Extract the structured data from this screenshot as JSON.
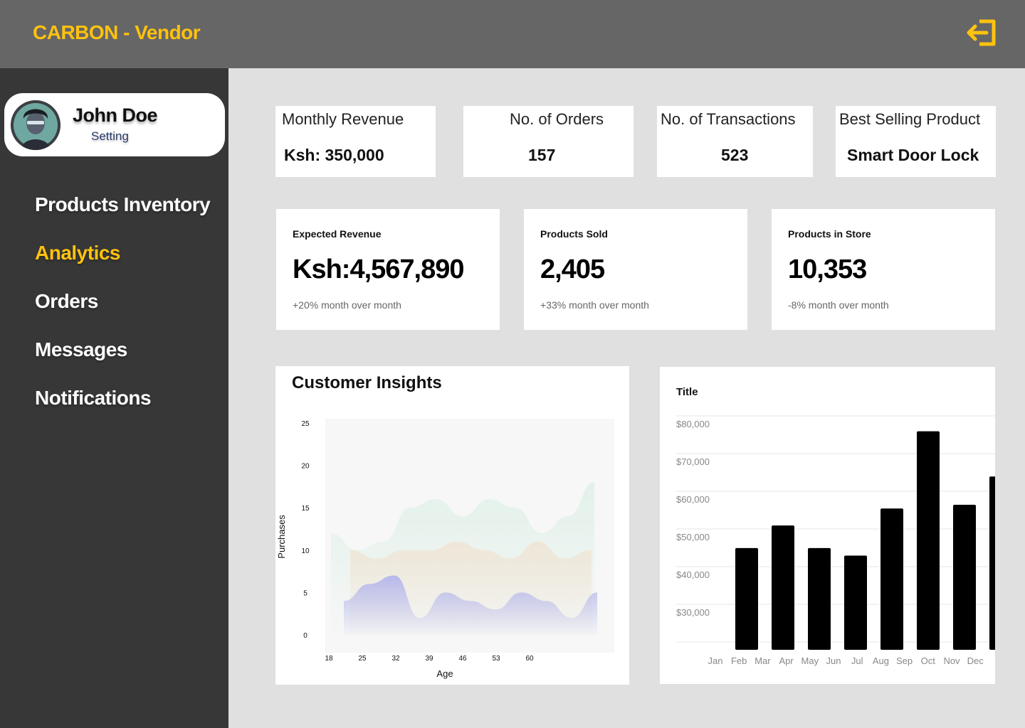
{
  "app": {
    "brand": "CARBON - Vendor"
  },
  "icons": {
    "logout": "logout-icon",
    "avatar": "user-avatar"
  },
  "colors": {
    "accent": "#ffc20e",
    "topbar": "#666666",
    "sidebar": "#373737",
    "background": "#e0e0e0"
  },
  "profile": {
    "name": "John Doe",
    "setting": "Setting"
  },
  "nav": [
    {
      "label": "Products Inventory",
      "active": false
    },
    {
      "label": "Analytics",
      "active": true
    },
    {
      "label": "Orders",
      "active": false
    },
    {
      "label": "Messages",
      "active": false
    },
    {
      "label": "Notifications",
      "active": false
    }
  ],
  "kpis": [
    {
      "title": "Monthly Revenue",
      "value": "Ksh: 350,000"
    },
    {
      "title": "No. of Orders",
      "value": "157"
    },
    {
      "title": "No. of Transactions",
      "value": "523"
    },
    {
      "title": "Best Selling Product",
      "value": "Smart Door Lock"
    }
  ],
  "stats": [
    {
      "label": "Expected Revenue",
      "value": "Ksh:4,567,890",
      "delta": "+20% month over month"
    },
    {
      "label": "Products Sold",
      "value": "2,405",
      "delta": "+33% month over month"
    },
    {
      "label": "Products in Store",
      "value": "10,353",
      "delta": "-8% month over month"
    }
  ],
  "chart_data": [
    {
      "type": "area",
      "title": "Customer Insights",
      "xlabel": "Age",
      "ylabel": "Purchases",
      "x_ticks": [
        "18",
        "25",
        "32",
        "39",
        "46",
        "53",
        "60"
      ],
      "y_ticks": [
        "25",
        "20",
        "15",
        "10",
        "5",
        "0"
      ],
      "ylim": [
        0,
        25
      ],
      "series": [
        {
          "color": "#e3f1ea",
          "values": [
            12,
            10,
            11,
            15,
            16,
            14,
            16,
            15,
            12,
            14,
            18
          ]
        },
        {
          "color": "#efe6d8",
          "values": [
            10,
            9,
            10,
            10,
            11,
            10,
            9,
            11,
            9,
            10
          ]
        },
        {
          "color": "#b7b9ec",
          "values": [
            4,
            6,
            7,
            2,
            5,
            4,
            3,
            5,
            4,
            2,
            5
          ]
        }
      ]
    },
    {
      "type": "bar",
      "title": "Title",
      "categories": [
        "Jan",
        "Feb",
        "Mar",
        "Apr",
        "May",
        "Jun",
        "Jul",
        "Aug",
        "Sep",
        "Oct",
        "Nov",
        "Dec"
      ],
      "values": [
        null,
        47000,
        53000,
        47000,
        45000,
        57500,
        78000,
        58500,
        66000,
        null,
        null,
        null
      ],
      "y_ticks": [
        "$80,000",
        "$70,000",
        "$60,000",
        "$50,000",
        "$40,000",
        "$30,000"
      ],
      "ylim": [
        20000,
        80000
      ],
      "color": "#000000"
    }
  ]
}
